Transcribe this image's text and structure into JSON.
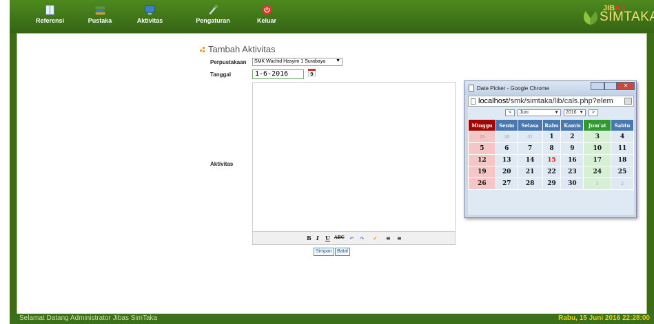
{
  "nav": {
    "items": [
      {
        "label": "Referensi",
        "icon": "book-icon"
      },
      {
        "label": "Pustaka",
        "icon": "books-stack-icon"
      },
      {
        "label": "Aktivitas",
        "icon": "monitor-icon"
      },
      {
        "label": "Pengaturan",
        "icon": "tools-icon"
      },
      {
        "label": "Keluar",
        "icon": "power-icon"
      }
    ]
  },
  "logo": {
    "prefix": "JIB",
    "mark": "AS",
    "main": "SIMTAKA"
  },
  "form": {
    "title": "Tambah Aktivitas",
    "library_label": "Perpustakaan",
    "library_value": "SMK Wachid Hasyim 1 Surabaya",
    "date_label": "Tanggal",
    "date_value": "1-6-2016",
    "activity_label": "Aktivitas",
    "save_label": "Simpan",
    "cancel_label": "Batal"
  },
  "editor_toolbar": [
    "B",
    "I",
    "U",
    "ABC",
    "↶",
    "↷",
    "✓",
    "≡",
    "≡"
  ],
  "datepicker": {
    "window_title": "Date Picker - Google Chrome",
    "url_host": "localhost",
    "url_path": "/smk/simtaka/lib/cals.php?elem",
    "prev_label": "<",
    "next_label": ">",
    "month": "Juni",
    "year": "2016",
    "weekdays": [
      "Minggu",
      "Senin",
      "Selasa",
      "Rabu",
      "Kamis",
      "Jum'at",
      "Sabtu"
    ],
    "weeks": [
      [
        "29",
        "30",
        "31",
        "1",
        "2",
        "3",
        "4"
      ],
      [
        "5",
        "6",
        "7",
        "8",
        "9",
        "10",
        "11"
      ],
      [
        "12",
        "13",
        "14",
        "15",
        "16",
        "17",
        "18"
      ],
      [
        "19",
        "20",
        "21",
        "22",
        "23",
        "24",
        "25"
      ],
      [
        "26",
        "27",
        "28",
        "29",
        "30",
        "1",
        "2"
      ]
    ],
    "today": "15"
  },
  "status": {
    "welcome": "Selamat Datang Administrator Jibas SimTaka",
    "datetime": "Rabu, 15 Juni 2016 22:28:00"
  },
  "colors": {
    "bar": "#3f6b17",
    "sunday": "#a30000",
    "friday": "#2f9a2f",
    "header": "#4978b0",
    "today": "#e0181b"
  }
}
